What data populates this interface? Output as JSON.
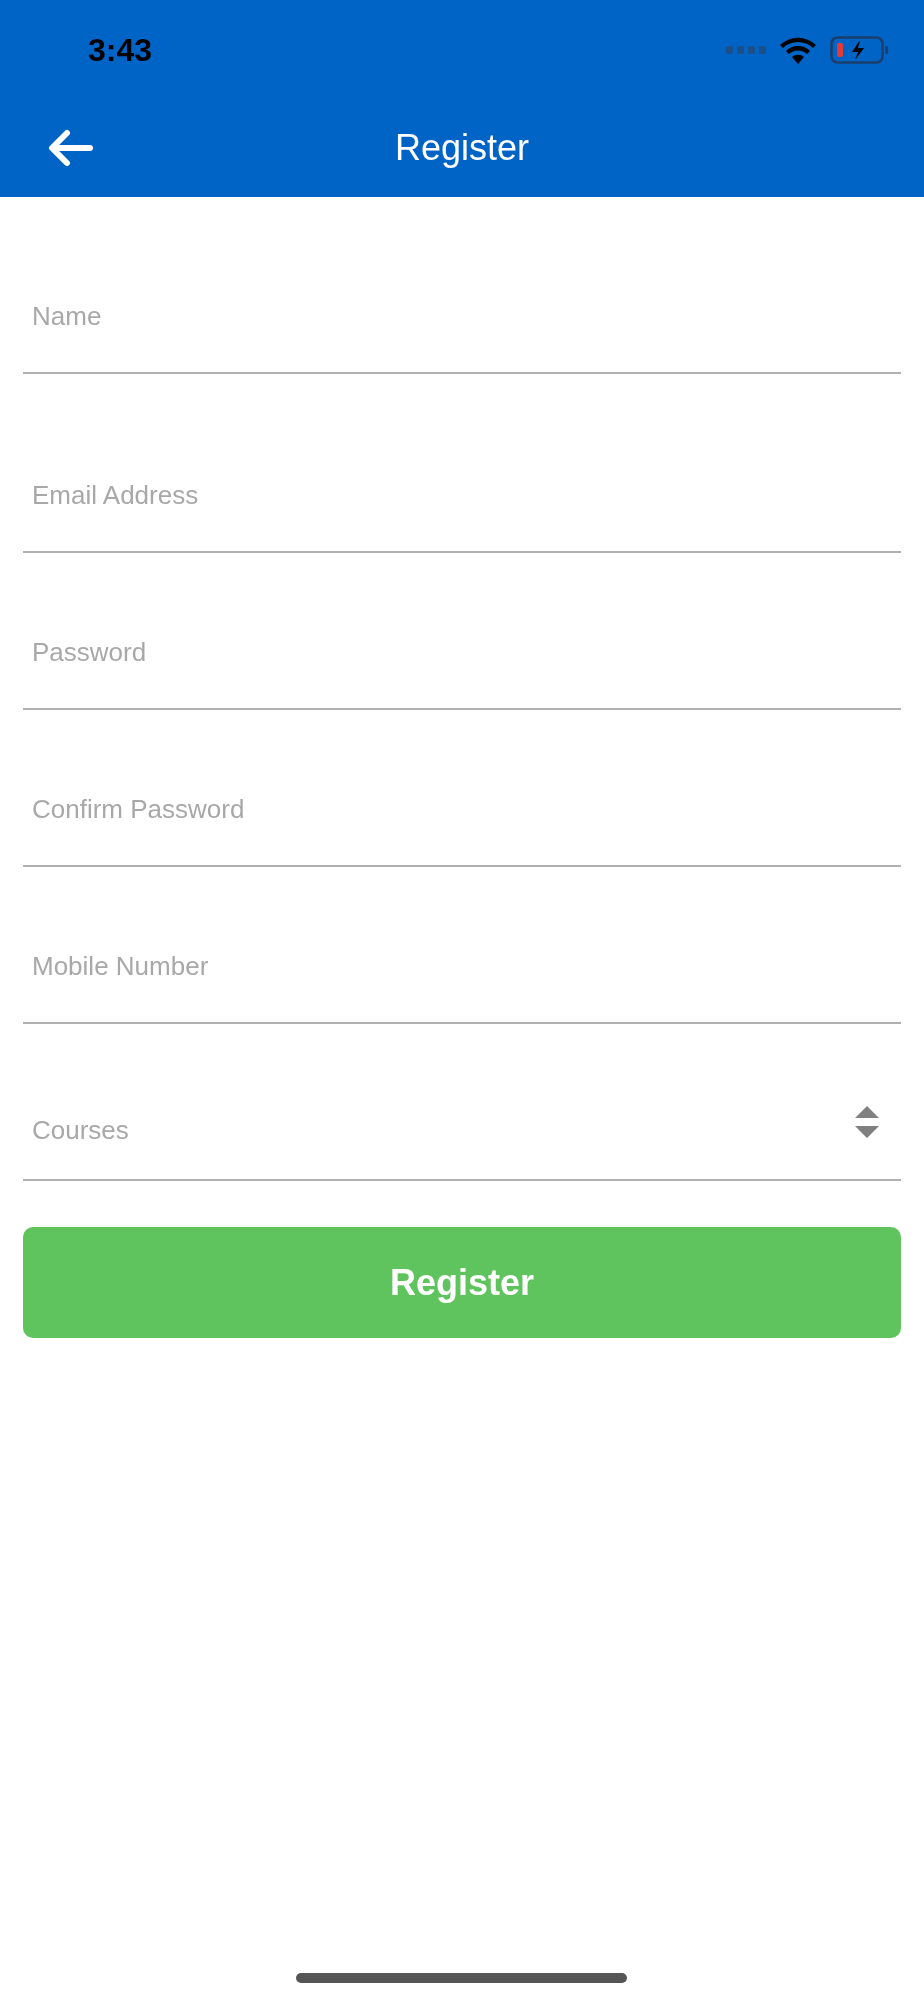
{
  "status_bar": {
    "time": "3:43"
  },
  "header": {
    "title": "Register"
  },
  "fields": [
    {
      "kind": "text",
      "placeholder": "Name"
    },
    {
      "kind": "text",
      "placeholder": "Email Address"
    },
    {
      "kind": "text",
      "placeholder": "Password"
    },
    {
      "kind": "text",
      "placeholder": "Confirm Password"
    },
    {
      "kind": "text",
      "placeholder": "Mobile Number"
    },
    {
      "kind": "select",
      "placeholder": "Courses"
    }
  ],
  "submit": {
    "label": "Register"
  }
}
